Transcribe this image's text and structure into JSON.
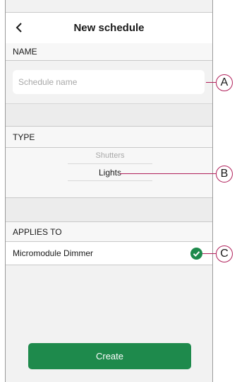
{
  "header": {
    "title": "New schedule"
  },
  "name_section": {
    "label": "NAME",
    "placeholder": "Schedule name"
  },
  "type_section": {
    "label": "TYPE",
    "options": [
      "Shutters",
      "Lights"
    ],
    "selected": "Lights"
  },
  "applies_section": {
    "label": "APPLIES TO",
    "device": "Micromodule Dimmer",
    "device_selected": true
  },
  "actions": {
    "create_label": "Create"
  },
  "callouts": [
    "A",
    "B",
    "C"
  ],
  "colors": {
    "accent": "#1e8a4c",
    "callout": "#b0205a"
  }
}
